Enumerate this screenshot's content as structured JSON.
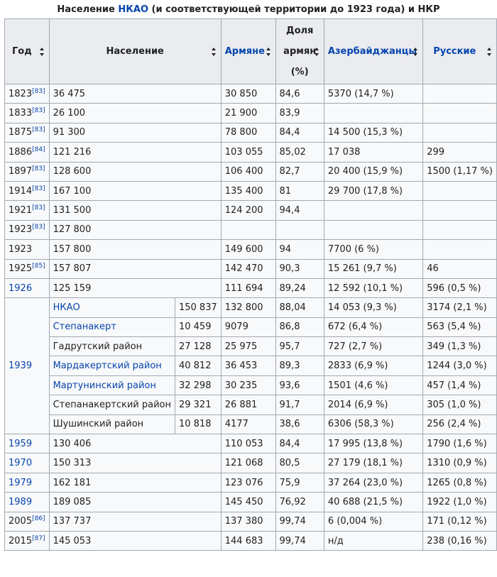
{
  "caption": {
    "prefix": "Население ",
    "link": "НКАО",
    "suffix": " (и соответствующей территории до 1923 года) и НКР"
  },
  "headers": {
    "year": "Год",
    "population": "Население",
    "armenians": "Армяне",
    "share_line1": "Доля",
    "share_line2": "армян",
    "share_line3": "(%)",
    "azerbaijanis": "Азербайджанцы",
    "russians": "Русские"
  },
  "rows": [
    {
      "year": "1823",
      "ref": "[83]",
      "population": "36 475",
      "armenians": "30 850",
      "share": "84,6",
      "azerbaijanis": "5370 (14,7 %)",
      "russians": ""
    },
    {
      "year": "1833",
      "ref": "[83]",
      "population": "26 100",
      "armenians": "21 900",
      "share": "83,9",
      "azerbaijanis": "",
      "russians": ""
    },
    {
      "year": "1875",
      "ref": "[83]",
      "population": "91 300",
      "armenians": "78 800",
      "share": "84,4",
      "azerbaijanis": "14 500 (15,3 %)",
      "russians": ""
    },
    {
      "year": "1886",
      "ref": "[84]",
      "population": "121 216",
      "armenians": "103 055",
      "share": "85,02",
      "azerbaijanis": "17 038",
      "russians": "299"
    },
    {
      "year": "1897",
      "ref": "[83]",
      "population": "128 600",
      "armenians": "106 400",
      "share": "82,7",
      "azerbaijanis": "20 400 (15,9 %)",
      "russians": "1500 (1,17 %)"
    },
    {
      "year": "1914",
      "ref": "[83]",
      "population": "167 100",
      "armenians": "135 400",
      "share": "81",
      "azerbaijanis": "29 700 (17,8 %)",
      "russians": ""
    },
    {
      "year": "1921",
      "ref": "[83]",
      "population": "131 500",
      "armenians": "124 200",
      "share": "94,4",
      "azerbaijanis": "",
      "russians": ""
    },
    {
      "year": "1923",
      "ref": "[83]",
      "population": "127 800",
      "armenians": "",
      "share": "",
      "azerbaijanis": "",
      "russians": ""
    },
    {
      "year": "1923",
      "ref": "",
      "population": "157 800",
      "armenians": "149 600",
      "share": "94",
      "azerbaijanis": "7700 (6 %)",
      "russians": ""
    },
    {
      "year": "1925",
      "ref": "[85]",
      "population": "157 807",
      "armenians": "142 470",
      "share": "90,3",
      "azerbaijanis": "15 261 (9,7 %)",
      "russians": "46"
    },
    {
      "year": "1926",
      "ref": "",
      "population": "125 159",
      "armenians": "111 694",
      "share": "89,24",
      "azerbaijanis": "12 592 (10,1 %)",
      "russians": "596 (0,5 %)"
    }
  ],
  "group_1939": {
    "year": "1939",
    "subrows": [
      {
        "name": "НКАО",
        "total": "150 837",
        "armenians": "132 800",
        "share": "88,04",
        "azerbaijanis": "14 053 (9,3 %)",
        "russians": "3174 (2,1 %)"
      },
      {
        "name": "Степанакерт",
        "total": "10 459",
        "armenians": "9079",
        "share": "86,8",
        "azerbaijanis": "672 (6,4 %)",
        "russians": "563 (5,4 %)"
      },
      {
        "name": "Гадрутский район",
        "total": "27 128",
        "armenians": "25 975",
        "share": "95,7",
        "azerbaijanis": "727 (2,7 %)",
        "russians": "349 (1,3 %)"
      },
      {
        "name": "Мардакертский район",
        "total": "40 812",
        "armenians": "36 453",
        "share": "89,3",
        "azerbaijanis": "2833 (6,9 %)",
        "russians": "1244 (3,0 %)"
      },
      {
        "name": "Мартунинский район",
        "total": "32 298",
        "armenians": "30 235",
        "share": "93,6",
        "azerbaijanis": "1501 (4,6 %)",
        "russians": "457 (1,4 %)"
      },
      {
        "name": "Степанакертский район",
        "total": "29 321",
        "armenians": "26 881",
        "share": "91,7",
        "azerbaijanis": "2014 (6,9 %)",
        "russians": "305 (1,0 %)"
      },
      {
        "name": "Шушинский район",
        "total": "10 818",
        "armenians": "4177",
        "share": "38,6",
        "azerbaijanis": "6306 (58,3 %)",
        "russians": "256 (2,4 %)"
      }
    ]
  },
  "rows_after": [
    {
      "year": "1959",
      "ref": "",
      "population": "130 406",
      "armenians": "110 053",
      "share": "84,4",
      "azerbaijanis": "17 995 (13,8 %)",
      "russians": "1790 (1,6 %)"
    },
    {
      "year": "1970",
      "ref": "",
      "population": "150 313",
      "armenians": "121 068",
      "share": "80,5",
      "azerbaijanis": "27 179 (18,1 %)",
      "russians": "1310 (0,9 %)"
    },
    {
      "year": "1979",
      "ref": "",
      "population": "162 181",
      "armenians": "123 076",
      "share": "75,9",
      "azerbaijanis": "37 264 (23,0 %)",
      "russians": "1265 (0,8 %)"
    },
    {
      "year": "1989",
      "ref": "",
      "population": "189 085",
      "armenians": "145 450",
      "share": "76,92",
      "azerbaijanis": "40 688 (21,5 %)",
      "russians": "1922 (1,0 %)"
    },
    {
      "year": "2005",
      "ref": "[86]",
      "population": "137 737",
      "armenians": "137 380",
      "share": "99,74",
      "azerbaijanis": "6 (0,004 %)",
      "russians": "171 (0,12 %)"
    },
    {
      "year": "2015",
      "ref": "[87]",
      "population": "145 053",
      "armenians": "144 683",
      "share": "99,74",
      "azerbaijanis": "н/д",
      "russians": "238 (0,16 %)"
    }
  ],
  "colors": {
    "link": "#0645ad",
    "header_bg": "#eaecf0",
    "cell_bg": "#f8f9fa",
    "border": "#a2a9b1"
  }
}
